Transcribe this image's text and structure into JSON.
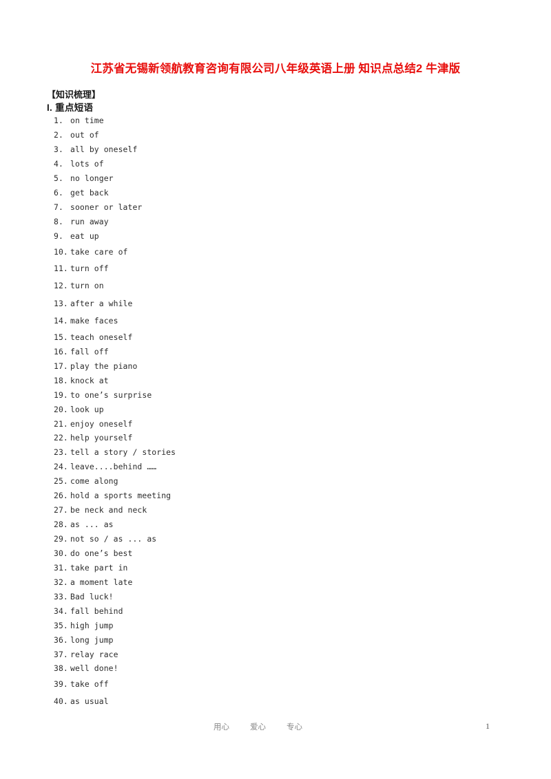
{
  "document": {
    "title": "江苏省无锡新领航教育咨询有限公司八年级英语上册 知识点总结2 牛津版",
    "title_color": "#e8100e",
    "section_bracket_heading": "【知识梳理】",
    "section_heading": "I.  重点短语"
  },
  "phrases": [
    {
      "num": "1.",
      "text": "on time"
    },
    {
      "num": "2.",
      "text": "out of"
    },
    {
      "num": "3.",
      "text": "all by oneself"
    },
    {
      "num": "4.",
      "text": "lots of"
    },
    {
      "num": "5.",
      "text": "no longer"
    },
    {
      "num": "6.",
      "text": "get back"
    },
    {
      "num": "7.",
      "text": "sooner or later"
    },
    {
      "num": "8.",
      "text": "run away"
    },
    {
      "num": "9.",
      "text": "eat up"
    },
    {
      "num": "10.",
      "text": "take care of"
    },
    {
      "num": "11.",
      "text": "turn off"
    },
    {
      "num": "12.",
      "text": "turn on"
    },
    {
      "num": "13.",
      "text": "after a while"
    },
    {
      "num": "14.",
      "text": "make faces"
    },
    {
      "num": "15.",
      "text": "teach oneself"
    },
    {
      "num": "16.",
      "text": "fall off"
    },
    {
      "num": "17.",
      "text": "play the piano"
    },
    {
      "num": "18.",
      "text": "knock at"
    },
    {
      "num": "19.",
      "text": "to one’s surprise"
    },
    {
      "num": "20.",
      "text": "look up"
    },
    {
      "num": "21.",
      "text": "enjoy oneself"
    },
    {
      "num": "22.",
      "text": "help yourself"
    },
    {
      "num": "23.",
      "text": "tell a story / stories"
    },
    {
      "num": "24.",
      "text": "leave....behind ……"
    },
    {
      "num": "25.",
      "text": "come along"
    },
    {
      "num": "26.",
      "text": "hold a sports meeting"
    },
    {
      "num": "27.",
      "text": "be neck and neck"
    },
    {
      "num": "28.",
      "text": "as ... as"
    },
    {
      "num": "29.",
      "text": "not so / as ... as"
    },
    {
      "num": "30.",
      "text": "do one’s best"
    },
    {
      "num": "31.",
      "text": "take part in"
    },
    {
      "num": "32.",
      "text": "a moment late"
    },
    {
      "num": "33.",
      "text": "Bad luck!"
    },
    {
      "num": "34.",
      "text": "fall behind"
    },
    {
      "num": "35.",
      "text": "high jump"
    },
    {
      "num": "36.",
      "text": "long jump"
    },
    {
      "num": "37.",
      "text": "relay race"
    },
    {
      "num": "38.",
      "text": "well done!"
    },
    {
      "num": "39.",
      "text": "take off"
    },
    {
      "num": "40.",
      "text": "as usual"
    }
  ],
  "footer": {
    "motto": [
      "用心",
      "爱心",
      "专心"
    ],
    "page_number": "1"
  }
}
